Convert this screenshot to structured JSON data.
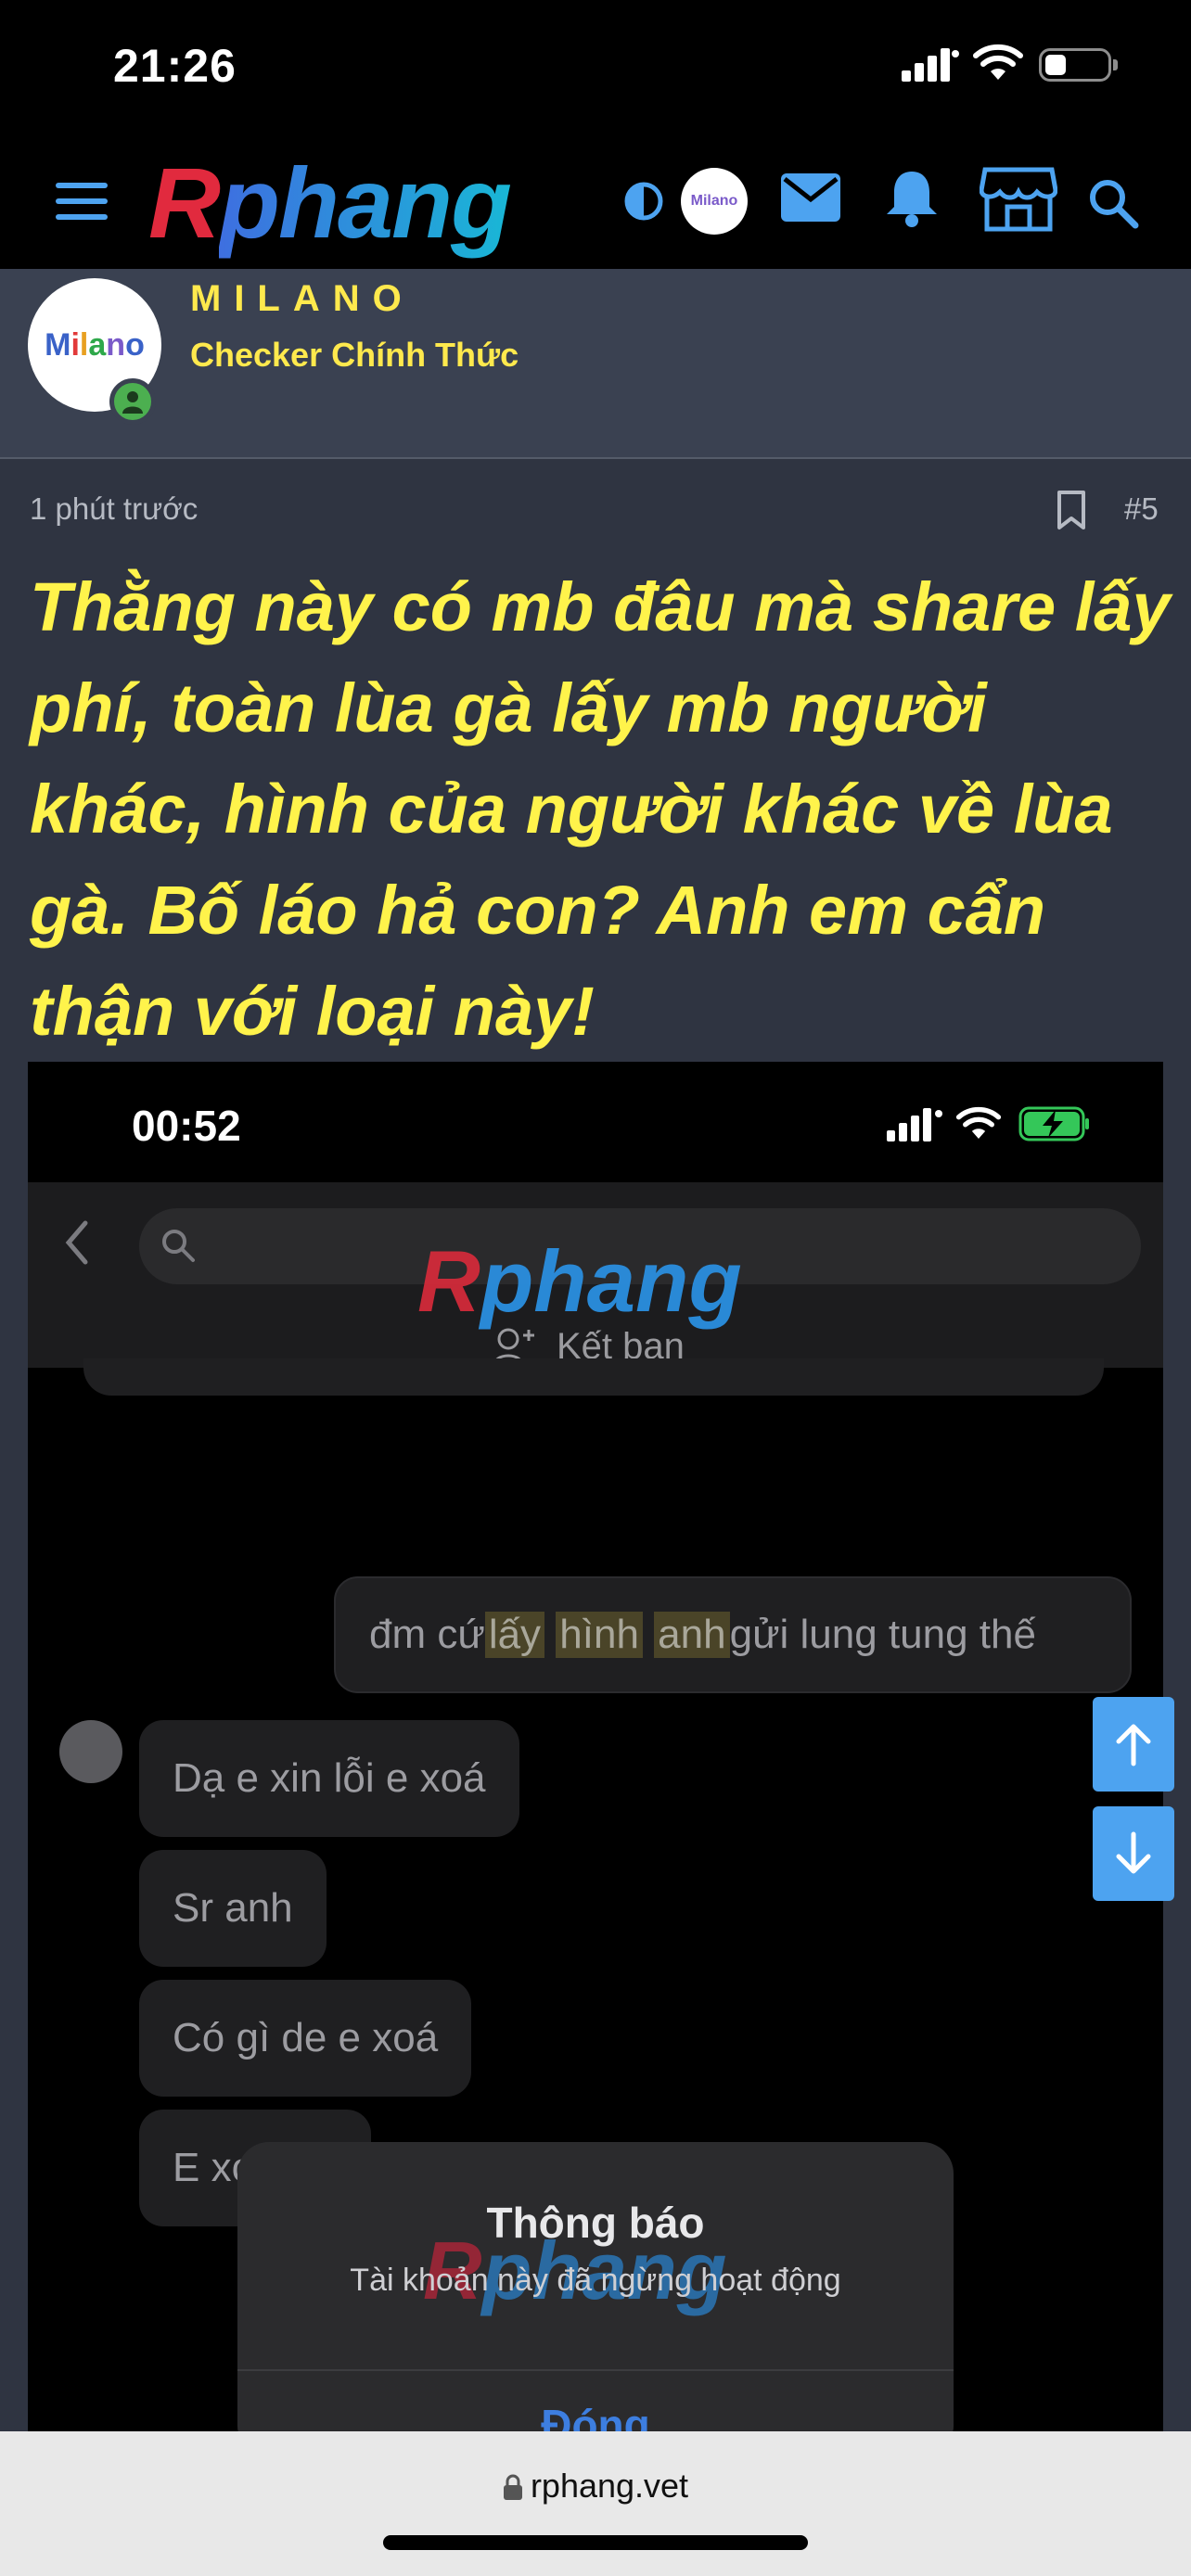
{
  "status_bar": {
    "time": "21:26"
  },
  "nav": {
    "logo_part1": "R",
    "logo_part2": "phang",
    "avatar_text": "Milano",
    "icons": [
      "menu-icon",
      "theme-toggle-icon",
      "mail-icon",
      "bell-icon",
      "store-icon",
      "search-icon"
    ]
  },
  "poster": {
    "avatar_text": [
      "M",
      "i",
      "l",
      "a",
      "n",
      "o"
    ],
    "username": "MILANO",
    "title": "Checker Chính Thức"
  },
  "post": {
    "time": "1 phút trước",
    "number": "#5",
    "text": "Thằng này có mb đâu mà share lấy phí, toàn lùa gà lấy mb người khác, hình của người khác về lùa gà. Bố láo hả con? Anh em cẩn thận với loại này!"
  },
  "embedded_screenshot": {
    "time": "00:52",
    "watermark_part1": "R",
    "watermark_part2": "phang",
    "add_friend": "Kết bạn",
    "my_message": {
      "pre": "đm cứ ",
      "hl1": "lấy",
      "hl2": "hình",
      "hl3": "anh",
      "post": " gửi lung tung thế"
    },
    "their_messages": [
      "Dạ e xin lỗi e xoá",
      "Sr anh",
      "Có gì de e xoá",
      "E xo"
    ],
    "dialog": {
      "title": "Thông báo",
      "message": "Tài khoản này đã ngừng hoạt động",
      "button": "Đóng"
    }
  },
  "browser": {
    "url": "rphang.vet"
  },
  "colors": {
    "accent": "#4da3f0",
    "post_text": "#fff34b",
    "brand_red": "#e12a3e",
    "brand_blue": "#2a8fe0"
  }
}
